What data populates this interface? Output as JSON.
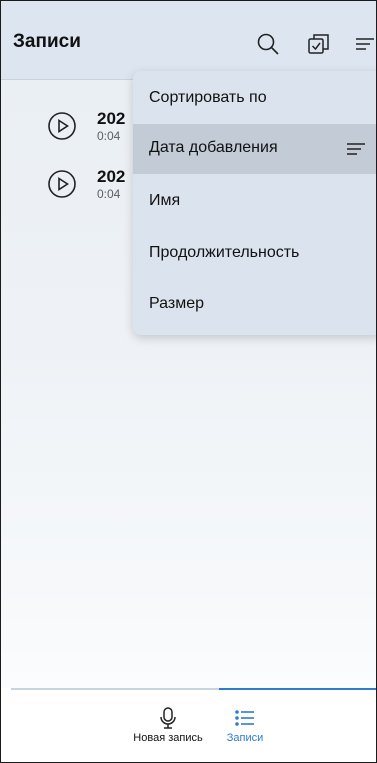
{
  "appbar": {
    "title": "Записи"
  },
  "recordings": [
    {
      "name": "202",
      "duration": "0:04"
    },
    {
      "name": "202",
      "duration": "0:04"
    }
  ],
  "sort_menu": {
    "header": "Сортировать по",
    "items": [
      {
        "label": "Дата добавления",
        "selected": true
      },
      {
        "label": "Имя",
        "selected": false
      },
      {
        "label": "Продолжительность",
        "selected": false
      },
      {
        "label": "Размер",
        "selected": false
      }
    ]
  },
  "bottom_nav": {
    "items": [
      {
        "label": "Новая запись",
        "icon": "microphone-icon",
        "active": false
      },
      {
        "label": "Записи",
        "icon": "list-icon",
        "active": true
      }
    ]
  },
  "colors": {
    "accent": "#2f7bd1",
    "appbar": "#dde6f0",
    "menu": "#dbe4ee",
    "menu_selected": "#c3ccd6"
  }
}
